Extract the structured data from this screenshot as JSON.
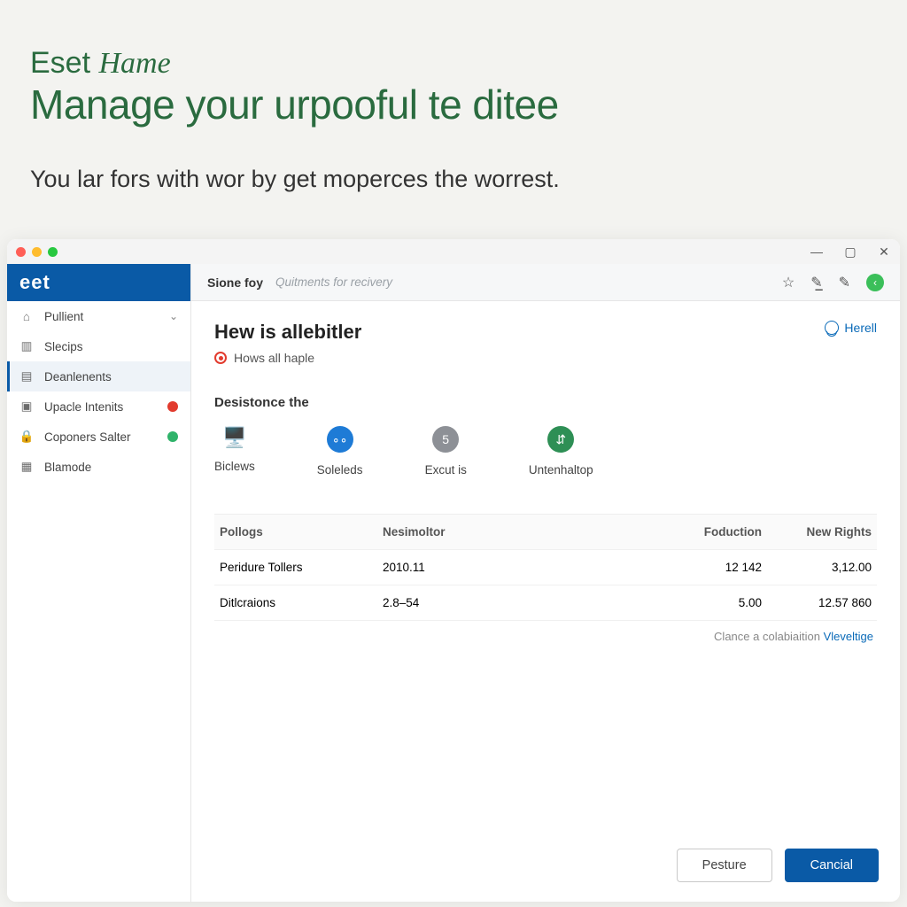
{
  "hero": {
    "brand_main": "Eset",
    "brand_sub": "Hame",
    "title": "Manage your urpooful te ditee",
    "tagline": "You lar fors with wor by get moperces the worrest."
  },
  "window": {
    "brand": "eet",
    "tabs": {
      "active": "Sione foy",
      "secondary": "Quitments for recivery"
    },
    "sidebar": [
      {
        "label": "Pullient",
        "icon": "home",
        "chevron": true
      },
      {
        "label": "Slecips",
        "icon": "stack"
      },
      {
        "label": "Deanlenents",
        "icon": "doc",
        "active": true
      },
      {
        "label": "Upacle Intenits",
        "icon": "case",
        "badge": "red"
      },
      {
        "label": "Coponers Salter",
        "icon": "lock",
        "badge": "green"
      },
      {
        "label": "Blamode",
        "icon": "panel"
      }
    ],
    "top_link": "Herell",
    "heading": "Hew is allebitler",
    "subheading": "Hows all haple",
    "section_label": "Desistonce the",
    "tiles": [
      {
        "label": "Biclews",
        "style": "plain"
      },
      {
        "label": "Soleleds",
        "style": "blue"
      },
      {
        "label": "Excut is",
        "style": "grey"
      },
      {
        "label": "Untenhaltop",
        "style": "green"
      }
    ],
    "table": {
      "headers": [
        "Pollogs",
        "Nesimoltor",
        "Foduction",
        "New Rights"
      ],
      "rows": [
        {
          "c1": "Peridure Tollers",
          "c2": "2010.11",
          "c3": "12 142",
          "c4": "3,12.00"
        },
        {
          "c1": "Ditlcraions",
          "c2": "2.8–54",
          "c3": "5.00",
          "c4": "12.57 860"
        }
      ],
      "footer_text": "Clance a colabiaition ",
      "footer_link": "Vleveltige"
    },
    "buttons": {
      "secondary": "Pesture",
      "primary": "Cancial"
    }
  }
}
